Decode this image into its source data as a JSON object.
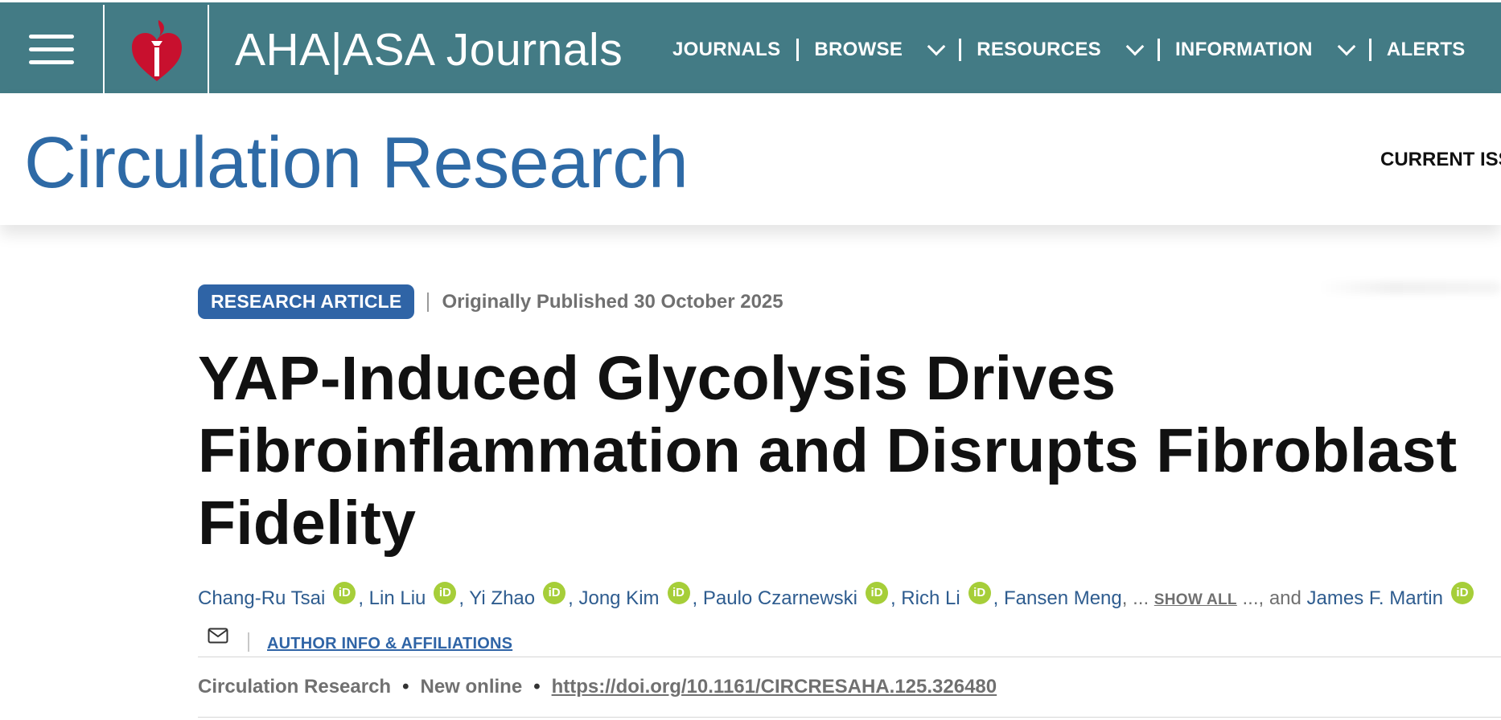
{
  "topbar": {
    "brand": "AHA|ASA Journals",
    "nav": [
      {
        "label": "JOURNALS",
        "dropdown": false
      },
      {
        "label": "BROWSE",
        "dropdown": true
      },
      {
        "label": "RESOURCES",
        "dropdown": true
      },
      {
        "label": "INFORMATION",
        "dropdown": true
      },
      {
        "label": "ALERTS",
        "dropdown": false
      }
    ],
    "icons": [
      "menu-icon",
      "heart-torch-logo"
    ]
  },
  "journal": {
    "title": "Circulation Research",
    "current_issue": "CURRENT ISS"
  },
  "article": {
    "type_badge": "RESEARCH ARTICLE",
    "published": "Originally Published 30 October 2025",
    "title": "YAP-Induced Glycolysis Drives Fibroinflammation and Disrupts Fibroblast Fidelity",
    "authors": [
      "Chang-Ru Tsai",
      "Lin Liu",
      "Yi Zhao",
      "Jong Kim",
      "Paulo Czarnewski",
      "Rich Li",
      "Fansen Meng"
    ],
    "ellipsis": "...",
    "show_all": "SHOW ALL",
    "and_text": "..., and",
    "last_author": "James F. Martin",
    "orcid_label": "iD",
    "affiliations_link": "AUTHOR INFO & AFFILIATIONS",
    "journal_name": "Circulation Research",
    "status": "New online",
    "doi": "https://doi.org/10.1161/CIRCRESAHA.125.326480"
  },
  "colors": {
    "topbar": "#437b85",
    "journal_title": "#2e6aa6",
    "badge": "#2f64a6",
    "author_link": "#2e5c8f",
    "orcid": "#a6ce39"
  }
}
